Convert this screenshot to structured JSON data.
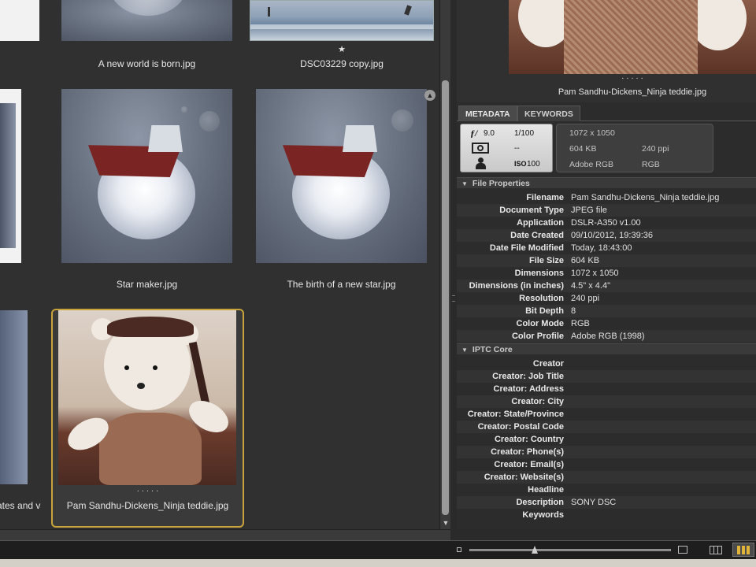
{
  "grid": {
    "thumbnails": [
      {
        "filename": "A new world is born.jpg"
      },
      {
        "filename": "DSC03229 copy.jpg",
        "rating": "★"
      },
      {
        "filename": "Star maker.jpg"
      },
      {
        "filename": "The birth of a new star.jpg"
      },
      {
        "filename": "Pam Sandhu-Dickens_Ninja teddie.jpg",
        "dots": "· · · · ·",
        "selected": true
      },
      {
        "filename_partial": "ates and v"
      }
    ]
  },
  "preview": {
    "filename": "Pam Sandhu-Dickens_Ninja teddie.jpg",
    "dots": "· · · · ·"
  },
  "tabs": [
    {
      "label": "METADATA",
      "active": true
    },
    {
      "label": "KEYWORDS",
      "active": false
    }
  ],
  "placard": {
    "aperture": "9.0",
    "aperture_symbol": "ƒ/",
    "shutter": "1/100",
    "exposure_comp": "--",
    "iso_label": "ISO",
    "iso": "100",
    "dimensions": "1072 x 1050",
    "size": "604 KB",
    "resolution": "240 ppi",
    "profile": "Adobe RGB",
    "mode": "RGB"
  },
  "file_properties": {
    "title": "File Properties",
    "rows": [
      {
        "key": "Filename",
        "value": "Pam Sandhu-Dickens_Ninja teddie.jpg"
      },
      {
        "key": "Document Type",
        "value": "JPEG file"
      },
      {
        "key": "Application",
        "value": "DSLR-A350 v1.00"
      },
      {
        "key": "Date Created",
        "value": "09/10/2012, 19:39:36"
      },
      {
        "key": "Date File Modified",
        "value": "Today, 18:43:00"
      },
      {
        "key": "File Size",
        "value": "604 KB"
      },
      {
        "key": "Dimensions",
        "value": "1072 x 1050"
      },
      {
        "key": "Dimensions (in inches)",
        "value": "4.5\" x 4.4\""
      },
      {
        "key": "Resolution",
        "value": "240 ppi"
      },
      {
        "key": "Bit Depth",
        "value": "8"
      },
      {
        "key": "Color Mode",
        "value": "RGB"
      },
      {
        "key": "Color Profile",
        "value": "Adobe RGB (1998)"
      }
    ]
  },
  "iptc": {
    "title": "IPTC Core",
    "rows": [
      {
        "key": "Creator",
        "value": ""
      },
      {
        "key": "Creator: Job Title",
        "value": ""
      },
      {
        "key": "Creator: Address",
        "value": ""
      },
      {
        "key": "Creator: City",
        "value": ""
      },
      {
        "key": "Creator: State/Province",
        "value": ""
      },
      {
        "key": "Creator: Postal Code",
        "value": ""
      },
      {
        "key": "Creator: Country",
        "value": ""
      },
      {
        "key": "Creator: Phone(s)",
        "value": ""
      },
      {
        "key": "Creator: Email(s)",
        "value": ""
      },
      {
        "key": "Creator: Website(s)",
        "value": ""
      },
      {
        "key": "Headline",
        "value": ""
      },
      {
        "key": "Description",
        "value": "SONY DSC"
      },
      {
        "key": "Keywords",
        "value": ""
      }
    ]
  },
  "colors": {
    "selection": "#c8a23a",
    "panel": "#2c2c2c",
    "content": "#303030"
  }
}
